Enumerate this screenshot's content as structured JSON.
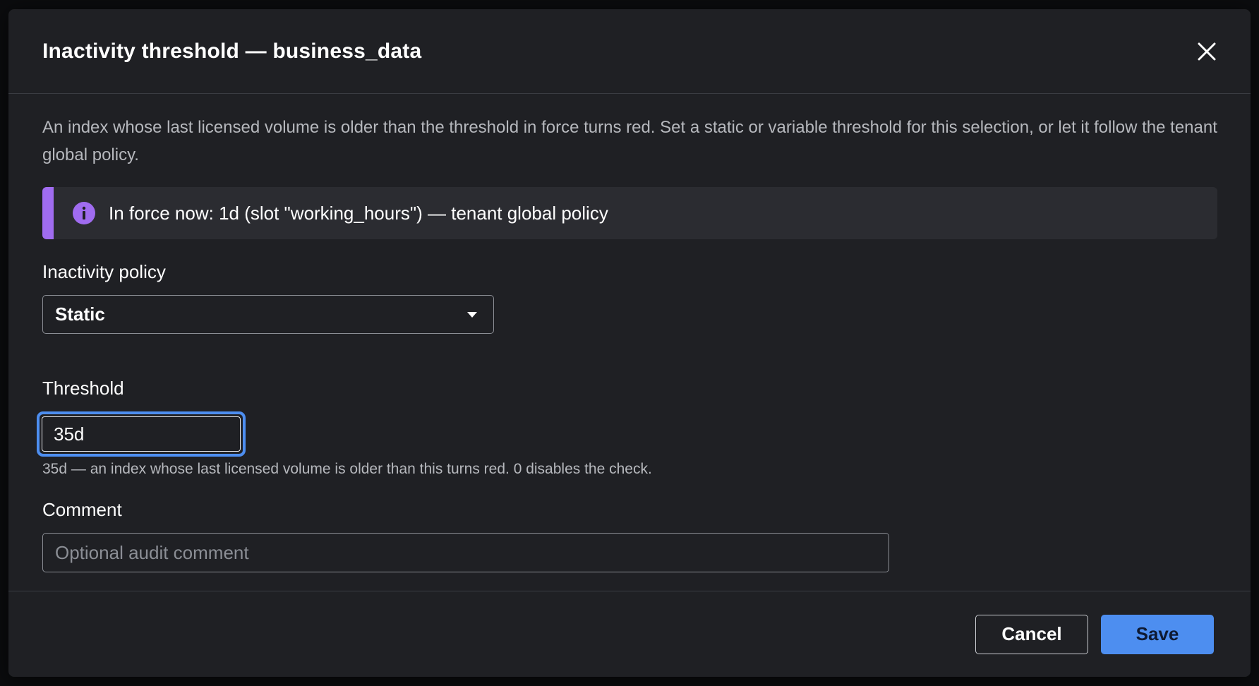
{
  "dialog": {
    "title": "Inactivity threshold — business_data",
    "close_icon": "close-icon",
    "description": "An index whose last licensed volume is older than the threshold in force turns red. Set a static or variable threshold for this selection, or let it follow the tenant global policy.",
    "callout": {
      "icon": "info-icon",
      "text": "In force now: 1d (slot \"working_hours\") — tenant global policy",
      "accent_color": "#a06cf0"
    },
    "policy": {
      "label": "Inactivity policy",
      "selected": "Static",
      "chevron_icon": "caret-down-icon"
    },
    "threshold": {
      "label": "Threshold",
      "value": "35d",
      "help": "35d — an index whose last licensed volume is older than this turns red. 0 disables the check."
    },
    "comment": {
      "label": "Comment",
      "value": "",
      "placeholder": "Optional audit comment"
    },
    "footer": {
      "cancel_label": "Cancel",
      "save_label": "Save",
      "save_color": "#4d8ef0"
    }
  }
}
